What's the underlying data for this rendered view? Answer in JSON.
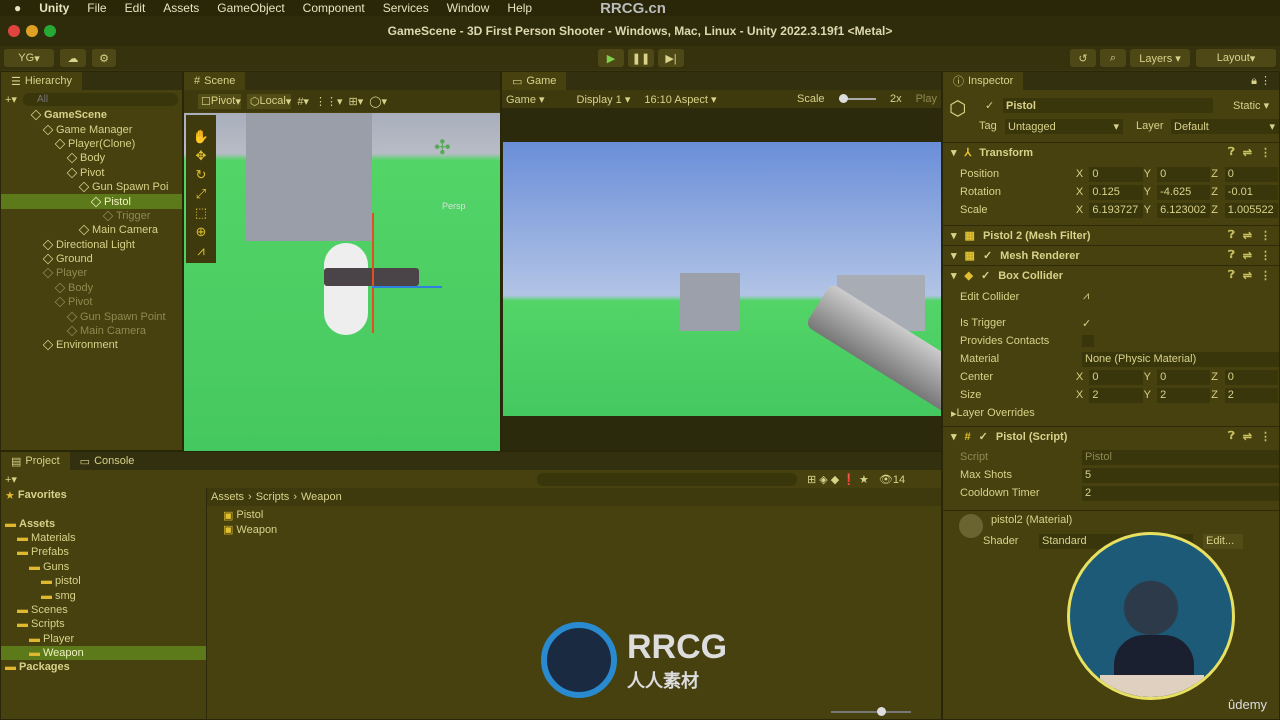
{
  "menubar": {
    "items": [
      "Unity",
      "File",
      "Edit",
      "Assets",
      "GameObject",
      "Component",
      "Services",
      "Window",
      "Help"
    ]
  },
  "window": {
    "title": "GameScene - 3D First Person Shooter - Windows, Mac, Linux - Unity 2022.3.19f1 <Metal>"
  },
  "toolbar": {
    "account": "YG",
    "layout": "Layout"
  },
  "hierarchy": {
    "tab": "Hierarchy",
    "search_placeholder": "All",
    "items": [
      {
        "label": "GameScene",
        "depth": 0,
        "state": "normal",
        "scene": true
      },
      {
        "label": "Game Manager",
        "depth": 1,
        "state": "normal"
      },
      {
        "label": "Player(Clone)",
        "depth": 2,
        "state": "normal"
      },
      {
        "label": "Body",
        "depth": 3,
        "state": "normal"
      },
      {
        "label": "Pivot",
        "depth": 3,
        "state": "normal"
      },
      {
        "label": "Gun Spawn Poi",
        "depth": 4,
        "state": "normal"
      },
      {
        "label": "Pistol",
        "depth": 5,
        "state": "selected"
      },
      {
        "label": "Trigger",
        "depth": 6,
        "state": "dim"
      },
      {
        "label": "Main Camera",
        "depth": 4,
        "state": "normal"
      },
      {
        "label": "Directional Light",
        "depth": 1,
        "state": "normal"
      },
      {
        "label": "Ground",
        "depth": 1,
        "state": "normal"
      },
      {
        "label": "Player",
        "depth": 1,
        "state": "dim"
      },
      {
        "label": "Body",
        "depth": 2,
        "state": "dim"
      },
      {
        "label": "Pivot",
        "depth": 2,
        "state": "dim"
      },
      {
        "label": "Gun Spawn Point",
        "depth": 3,
        "state": "dim"
      },
      {
        "label": "Main Camera",
        "depth": 3,
        "state": "dim"
      },
      {
        "label": "Environment",
        "depth": 1,
        "state": "normal"
      }
    ]
  },
  "scene": {
    "tab": "Scene",
    "pivot": "Pivot",
    "local": "Local",
    "persp": "Persp"
  },
  "game": {
    "tab": "Game",
    "mode": "Game",
    "display": "Display 1",
    "aspect": "16:10 Aspect",
    "scale_label": "Scale",
    "scale_value": "2x",
    "play_label": "Play"
  },
  "inspector": {
    "tab": "Inspector",
    "object_name": "Pistol",
    "static_label": "Static",
    "tag_label": "Tag",
    "tag": "Untagged",
    "layer_label": "Layer",
    "layer": "Default",
    "transform": {
      "title": "Transform",
      "position": {
        "label": "Position",
        "x": "0",
        "y": "0",
        "z": "0"
      },
      "rotation": {
        "label": "Rotation",
        "x": "0.125",
        "y": "-4.625",
        "z": "-0.01"
      },
      "scale": {
        "label": "Scale",
        "x": "6.193727",
        "y": "6.123002",
        "z": "1.005522"
      }
    },
    "mesh_filter": "Pistol 2 (Mesh Filter)",
    "mesh_renderer": "Mesh Renderer",
    "box_collider": {
      "title": "Box Collider",
      "edit_collider": "Edit Collider",
      "is_trigger": "Is Trigger",
      "is_trigger_checked": true,
      "provides_contacts": "Provides Contacts",
      "material_label": "Material",
      "material": "None (Physic Material)",
      "center": {
        "label": "Center",
        "x": "0",
        "y": "0",
        "z": "0"
      },
      "size": {
        "label": "Size",
        "x": "2",
        "y": "2",
        "z": "2"
      },
      "layer_overrides": "Layer Overrides"
    },
    "script": {
      "title": "Pistol (Script)",
      "script_label": "Script",
      "script_value": "Pistol",
      "max_shots_label": "Max Shots",
      "max_shots": "5",
      "cooldown_label": "Cooldown Timer",
      "cooldown": "2"
    },
    "material": {
      "title": "pistol2 (Material)",
      "shader_label": "Shader",
      "shader": "Standard",
      "edit": "Edit..."
    }
  },
  "project": {
    "tabs": [
      "Project",
      "Console"
    ],
    "badge": "14",
    "breadcrumb": [
      "Assets",
      "Scripts",
      "Weapon"
    ],
    "tree": [
      {
        "label": "Favorites",
        "depth": 0,
        "bold": true
      },
      {
        "label": "Assets",
        "depth": 0,
        "bold": true
      },
      {
        "label": "Materials",
        "depth": 1
      },
      {
        "label": "Prefabs",
        "depth": 1
      },
      {
        "label": "Guns",
        "depth": 2
      },
      {
        "label": "pistol",
        "depth": 3
      },
      {
        "label": "smg",
        "depth": 3
      },
      {
        "label": "Scenes",
        "depth": 1
      },
      {
        "label": "Scripts",
        "depth": 1
      },
      {
        "label": "Player",
        "depth": 2
      },
      {
        "label": "Weapon",
        "depth": 2,
        "selected": true
      },
      {
        "label": "Packages",
        "depth": 0,
        "bold": true
      }
    ],
    "files": [
      "Pistol",
      "Weapon"
    ]
  },
  "watermark": {
    "text": "RRCG.cn",
    "logo_text": "RRCG",
    "logo_sub": "人人素材",
    "udemy": "ûdemy"
  }
}
